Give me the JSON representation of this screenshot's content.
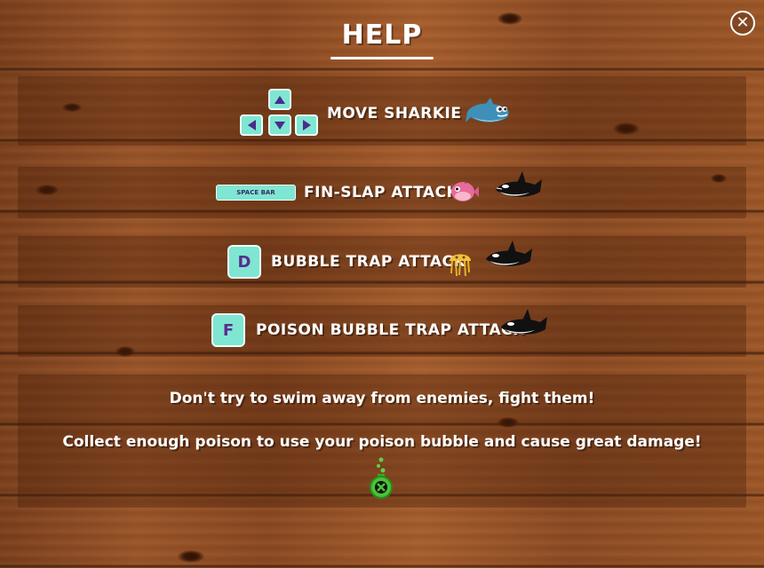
{
  "header": {
    "title": "HELP",
    "close_icon": "close-icon"
  },
  "controls": [
    {
      "keys": [
        "up",
        "left",
        "down",
        "right"
      ],
      "label": "MOVE SHARKIE",
      "icons": [
        "sharkie-icon"
      ]
    },
    {
      "key": "SPACE BAR",
      "label": "FIN-SLAP ATTACK",
      "icons": [
        "pufferfish-icon",
        "killer-whale-icon"
      ]
    },
    {
      "key": "D",
      "label": "BUBBLE TRAP ATTACK",
      "icons": [
        "jellyfish-icon",
        "killer-whale-icon"
      ]
    },
    {
      "key": "F",
      "label": "POISON BUBBLE TRAP ATTACK",
      "icons": [
        "killer-whale-icon"
      ]
    }
  ],
  "tips": [
    "Don't try to swim away from enemies, fight them!",
    "Collect enough poison to use your poison bubble and cause great damage!"
  ],
  "poison_icon": "poison-bottle-icon",
  "colors": {
    "key_bg": "#7fe6d2",
    "key_text": "#5b2c8f",
    "text": "#ffffff"
  }
}
